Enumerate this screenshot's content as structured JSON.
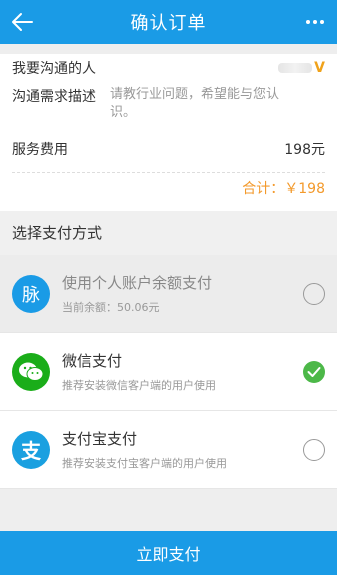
{
  "header": {
    "title": "确认订单",
    "back_icon": "back-arrow-icon",
    "more_icon": "more-dots-icon"
  },
  "order": {
    "person_label": "我要沟通的人",
    "person_badge": "V",
    "needs_label": "沟通需求描述",
    "needs_placeholder": "请教行业问题，希望能与您认识。",
    "fee_label": "服务费用",
    "fee_value": "198元",
    "total_text": "合计：￥198"
  },
  "payment": {
    "section_title": "选择支付方式",
    "methods": [
      {
        "name": "使用个人账户余额支付",
        "desc": "当前余额：50.06元",
        "icon_char": "脉",
        "icon_color": "#1a9be6",
        "selected": false,
        "disabled": true
      },
      {
        "name": "微信支付",
        "desc": "推荐安装微信客户端的用户使用",
        "icon_color": "#1aad19",
        "selected": true,
        "disabled": false
      },
      {
        "name": "支付宝支付",
        "desc": "推荐安装支付宝客户端的用户使用",
        "icon_char": "支",
        "icon_color": "#1aa0e0",
        "selected": false,
        "disabled": false
      }
    ]
  },
  "footer": {
    "pay_button": "立即支付"
  },
  "colors": {
    "primary": "#1a9be6",
    "accent_orange": "#f39a2c",
    "check_green": "#4cb848"
  }
}
